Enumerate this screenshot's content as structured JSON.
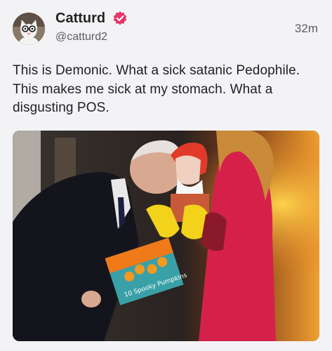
{
  "post": {
    "author": {
      "display_name": "Catturd",
      "handle": "@catturd2",
      "verified": true,
      "avatar_icon": "cat-with-glasses-avatar"
    },
    "timestamp": "32m",
    "text": "This is Demonic. What a sick satanic Pedophile. This makes me sick at my stomach. What a disgusting POS.",
    "media": {
      "type": "photo",
      "book_cover_text": "10 Spooky Pumpkins"
    }
  },
  "colors": {
    "background": "#f3f3f6",
    "verified_badge": "#e9346b",
    "handle_gray": "#5b5b66"
  }
}
